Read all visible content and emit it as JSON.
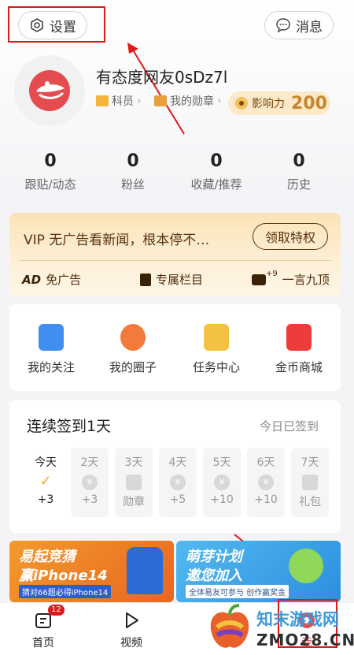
{
  "header": {
    "settings_label": "设置",
    "messages_label": "消息"
  },
  "profile": {
    "username": "有态度网友0sDz7l",
    "rank": "科员",
    "medals": "我的勋章",
    "influence_label": "影响力",
    "influence_value": "200"
  },
  "stats": [
    {
      "value": "0",
      "label": "跟贴/动态"
    },
    {
      "value": "0",
      "label": "粉丝"
    },
    {
      "value": "0",
      "label": "收藏/推荐"
    },
    {
      "value": "0",
      "label": "历史"
    }
  ],
  "vip": {
    "title": "VIP 无广告看新闻，根本停不…",
    "button": "领取特权",
    "perks": [
      "免广告",
      "专属栏目",
      "一言九顶"
    ],
    "perk_ad_mark": "AD",
    "perk_plus_mark": "+9"
  },
  "shortcuts": [
    "我的关注",
    "我的圈子",
    "任务中心",
    "金币商城"
  ],
  "checkin": {
    "title": "连续签到1天",
    "status": "今日已签到",
    "days": [
      {
        "day": "今天",
        "reward": "+3"
      },
      {
        "day": "2天",
        "reward": "+3"
      },
      {
        "day": "3天",
        "reward": "勋章"
      },
      {
        "day": "4天",
        "reward": "+5"
      },
      {
        "day": "5天",
        "reward": "+10"
      },
      {
        "day": "6天",
        "reward": "+10"
      },
      {
        "day": "7天",
        "reward": "礼包"
      }
    ],
    "coin_symbol": "¥"
  },
  "banners": {
    "left_title": "易起竞猜",
    "left_sub": "赢iPhone14",
    "left_note": "猜对66题必得iPhone14",
    "right_title": "萌芽计划",
    "right_sub": "邀您加入",
    "right_note": "全体易友可参与 创作赢奖金"
  },
  "tabbar": {
    "home": "首页",
    "home_badge": "12",
    "video": "视频",
    "me": "我"
  },
  "watermark": {
    "text": "知末游戏网",
    "domain": "ZMO28.CN"
  },
  "colors": {
    "annotation": "#e0171b",
    "gold": "#c7862b",
    "vip_text": "#5a3310"
  }
}
